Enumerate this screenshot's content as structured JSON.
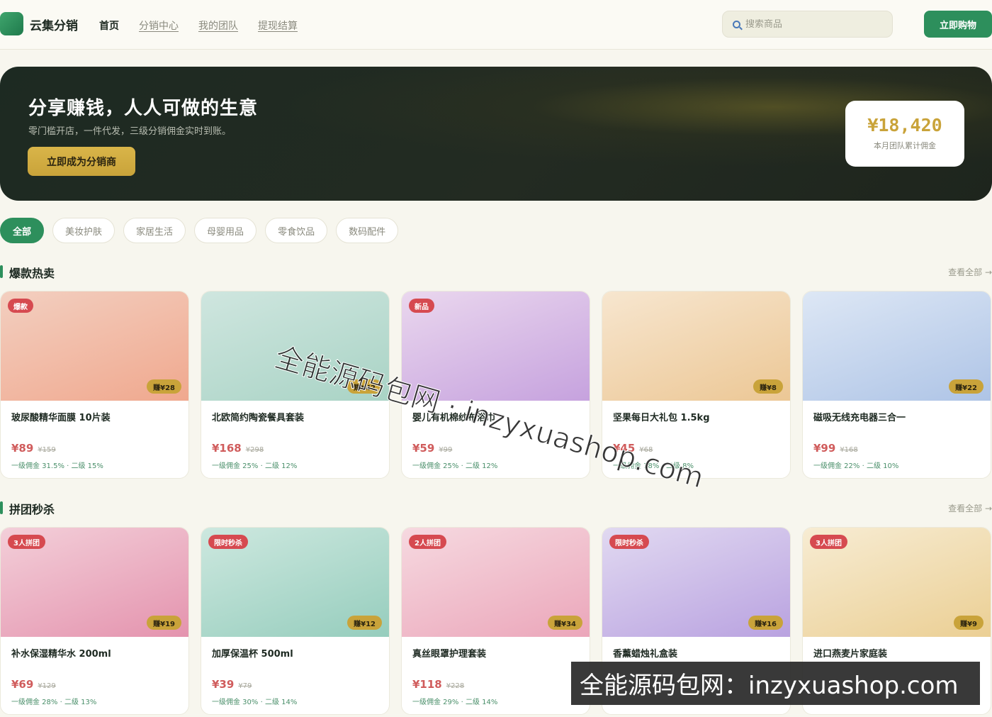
{
  "header": {
    "brand": "云集分销",
    "nav": [
      {
        "label": "首页",
        "active": true
      },
      {
        "label": "分销中心",
        "active": false
      },
      {
        "label": "我的团队",
        "active": false
      },
      {
        "label": "提现结算",
        "active": false
      }
    ],
    "search_placeholder": "搜索商品",
    "buy_label": "立即购物",
    "search_icon": "search-icon"
  },
  "hero": {
    "title": "分享赚钱，人人可做的生意",
    "subtitle": "零门槛开店，一件代发，三级分销佣金实时到账。",
    "button": "立即成为分销商",
    "stat_value": "¥18,420",
    "stat_label": "本月团队累计佣金"
  },
  "categories": [
    "全部",
    "美妆护肤",
    "家居生活",
    "母婴用品",
    "零食饮品",
    "数码配件"
  ],
  "sections": [
    {
      "title": "爆款热卖",
      "more": "查看全部 →",
      "products": [
        {
          "tag": "爆款",
          "earn": "赚¥28",
          "name": "玻尿酸精华面膜 10片装",
          "price": "¥89",
          "orig": "¥159",
          "comm": "一级佣金 31.5% · 二级 15%",
          "gradient": [
            "#f3cfc0",
            "#f0a88e"
          ]
        },
        {
          "tag": "",
          "earn": "赚¥42",
          "name": "北欧简约陶瓷餐具套装",
          "price": "¥168",
          "orig": "¥298",
          "comm": "一级佣金 25% · 二级 12%",
          "gradient": [
            "#cfe6df",
            "#a9d3c5"
          ]
        },
        {
          "tag": "新品",
          "earn": "",
          "name": "婴儿有机棉纱布浴巾",
          "price": "¥59",
          "orig": "¥99",
          "comm": "一级佣金 25% · 二级 12%",
          "gradient": [
            "#ead7ee",
            "#c6a2de"
          ]
        },
        {
          "tag": "",
          "earn": "赚¥8",
          "name": "坚果每日大礼包 1.5kg",
          "price": "¥45",
          "orig": "¥68",
          "comm": "一级佣金 18% · 二级 8%",
          "gradient": [
            "#f7e6cf",
            "#ecc795"
          ]
        },
        {
          "tag": "",
          "earn": "赚¥22",
          "name": "磁吸无线充电器三合一",
          "price": "¥99",
          "orig": "¥168",
          "comm": "一级佣金 22% · 二级 10%",
          "gradient": [
            "#dde7f5",
            "#aec4e6"
          ]
        }
      ]
    },
    {
      "title": "拼团秒杀",
      "more": "查看全部 →",
      "products": [
        {
          "tag": "3人拼团",
          "earn": "赚¥19",
          "name": "补水保湿精华水 200ml",
          "price": "¥69",
          "orig": "¥129",
          "comm": "一级佣金 28% · 二级 13%",
          "gradient": [
            "#f3cfd9",
            "#e493ae"
          ]
        },
        {
          "tag": "限时秒杀",
          "earn": "赚¥12",
          "name": "加厚保温杯 500ml",
          "price": "¥39",
          "orig": "¥79",
          "comm": "一级佣金 30% · 二级 14%",
          "gradient": [
            "#cde8df",
            "#96cdbd"
          ]
        },
        {
          "tag": "2人拼团",
          "earn": "赚¥34",
          "name": "真丝眼罩护理套装",
          "price": "¥118",
          "orig": "¥228",
          "comm": "一级佣金 29% · 二级 14%",
          "gradient": [
            "#f6d9e0",
            "#eba6ba"
          ]
        },
        {
          "tag": "限时秒杀",
          "earn": "赚¥16",
          "name": "香薰蜡烛礼盒装",
          "price": "",
          "orig": "",
          "comm": "",
          "gradient": [
            "#e1d9f1",
            "#b9a2e0"
          ]
        },
        {
          "tag": "3人拼团",
          "earn": "赚¥9",
          "name": "进口燕麦片家庭装",
          "price": "",
          "orig": "",
          "comm": "",
          "gradient": [
            "#f7ecd3",
            "#ebcf94"
          ]
        }
      ]
    }
  ],
  "watermark": {
    "diagonal": "全能源码包网 · inzyxuashop.com",
    "banner": "全能源码包网：inzyxuashop.com"
  },
  "colors": {
    "accent": "#2d8f5c",
    "gold": "#c9a33a",
    "price": "#d05c5c",
    "tag": "#d64a50"
  }
}
